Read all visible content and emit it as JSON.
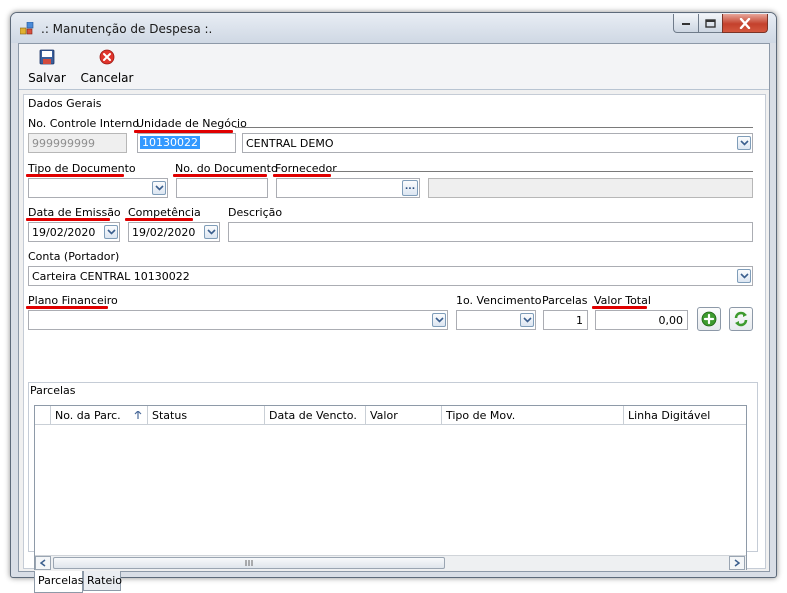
{
  "window": {
    "title": ".: Manutenção de Despesa :."
  },
  "toolbar": {
    "save_label": "Salvar",
    "cancel_label": "Cancelar"
  },
  "group": {
    "title": "Dados Gerais"
  },
  "form": {
    "controle_label": "No. Controle Interno",
    "controle_value": "999999999",
    "unidade_label": "Unidade de Negócio",
    "unidade_code": "10130022",
    "unidade_name": "CENTRAL DEMO",
    "tipo_doc_label": "Tipo de Documento",
    "tipo_doc_value": "",
    "num_doc_label": "No. do Documento",
    "num_doc_value": "",
    "fornecedor_label": "Fornecedor",
    "fornecedor_value": "",
    "fornecedor_name": "",
    "emissao_label": "Data de Emissão",
    "emissao_value": "19/02/2020",
    "competencia_label": "Competência",
    "competencia_value": "19/02/2020",
    "descricao_label": "Descrição",
    "descricao_value": "",
    "conta_label": "Conta (Portador)",
    "conta_value": "Carteira CENTRAL 10130022",
    "plano_label": "Plano Financeiro",
    "plano_value": "",
    "vencimento_label": "1o. Vencimento",
    "vencimento_value": "",
    "parcelas_label": "Parcelas",
    "parcelas_value": "1",
    "valor_label": "Valor Total",
    "valor_value": "0,00",
    "lookup_button": "..."
  },
  "parcelas": {
    "title": "Parcelas",
    "columns": [
      "No. da Parc.",
      "Status",
      "Data de Vencto.",
      "Valor",
      "Tipo de Mov.",
      "Linha Digitável"
    ],
    "rows": []
  },
  "tabs": [
    {
      "label": "Parcelas",
      "active": true
    },
    {
      "label": "Rateio",
      "active": false
    }
  ],
  "colors": {
    "accent_red": "#e00000",
    "title_gradient_top": "#e8edf4",
    "close_button": "#c4412c",
    "add_button": "#3e9b2f"
  }
}
